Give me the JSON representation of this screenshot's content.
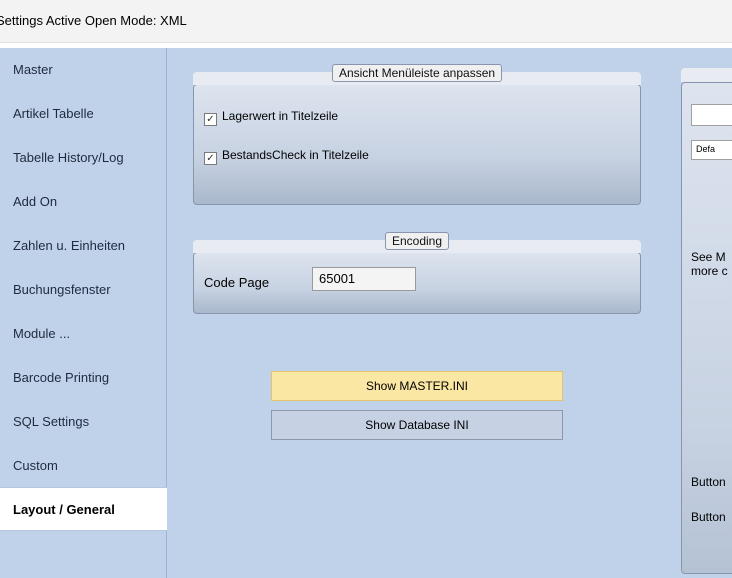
{
  "titlebar": {
    "title": "Settings Active Open Mode: XML"
  },
  "sidebar": {
    "items": [
      {
        "label": "Master"
      },
      {
        "label": "Artikel Tabelle"
      },
      {
        "label": "Tabelle History/Log"
      },
      {
        "label": "Add On"
      },
      {
        "label": "Zahlen u. Einheiten"
      },
      {
        "label": "Buchungsfenster"
      },
      {
        "label": "Module ..."
      },
      {
        "label": "Barcode Printing"
      },
      {
        "label": "SQL Settings"
      },
      {
        "label": "Custom"
      },
      {
        "label": "Layout / General",
        "active": true
      }
    ]
  },
  "menu_group": {
    "title": "Ansicht Menüleiste anpassen",
    "checkboxes": [
      {
        "label": "Lagerwert in Titelzeile",
        "checked": true
      },
      {
        "label": "BestandsCheck in Titelzeile",
        "checked": true
      }
    ]
  },
  "encoding_group": {
    "title": "Encoding",
    "code_page_label": "Code Page",
    "code_page_value": "65001"
  },
  "buttons": {
    "show_master": "Show MASTER.INI",
    "show_database": "Show Database INI"
  },
  "right_panel": {
    "combo_value": "",
    "small_field": "Defa",
    "see_more_line1": "See M",
    "see_more_line2": "more c",
    "button_label_1": "Button",
    "button_label_2": "Button"
  },
  "colors": {
    "sidebar_bg": "#c0d2ea",
    "highlight_button": "#fbe7a4",
    "normal_button": "#c6d2e3"
  }
}
